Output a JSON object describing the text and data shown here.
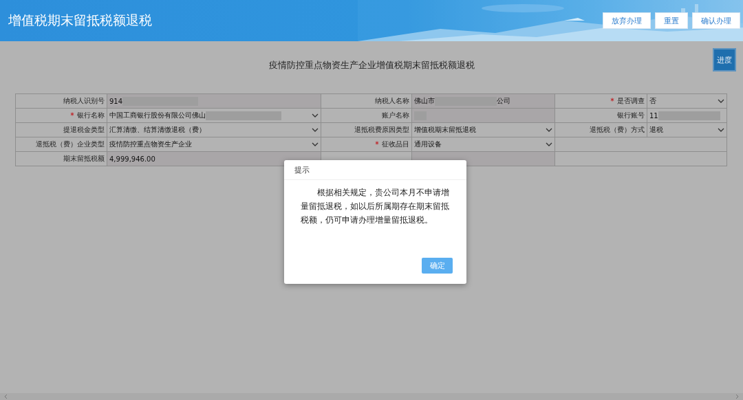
{
  "header": {
    "title": "增值税期末留抵税额退税",
    "buttons": [
      "放弃办理",
      "重置",
      "确认办理"
    ]
  },
  "page": {
    "title": "疫情防控重点物资生产企业增值税期末留抵税额退税",
    "progress_button": "进度"
  },
  "form": {
    "rows": [
      [
        {
          "label": "纳税人识别号",
          "required": false,
          "kind": "readonly",
          "segments": [
            {
              "kind": "text",
              "text": "914"
            },
            {
              "kind": "redacted"
            }
          ]
        },
        {
          "label": "纳税人名称",
          "required": false,
          "kind": "readonly",
          "segments": [
            {
              "kind": "text",
              "text": "佛山市"
            },
            {
              "kind": "redacted"
            },
            {
              "kind": "text",
              "text": "公司"
            }
          ]
        },
        {
          "label": "是否调查",
          "required": true,
          "kind": "select",
          "segments": [
            {
              "kind": "text",
              "text": "否"
            }
          ]
        }
      ],
      [
        {
          "label": "银行名称",
          "required": true,
          "kind": "select",
          "segments": [
            {
              "kind": "text",
              "text": "中国工商银行股份有限公司佛山"
            },
            {
              "kind": "redacted"
            }
          ]
        },
        {
          "label": "账户名称",
          "required": false,
          "kind": "readonly",
          "segments": [
            {
              "kind": "redacted"
            }
          ]
        },
        {
          "label": "银行账号",
          "required": false,
          "kind": "input",
          "segments": [
            {
              "kind": "text",
              "text": "11"
            },
            {
              "kind": "redacted"
            }
          ]
        }
      ],
      [
        {
          "label": "提退税金类型",
          "required": false,
          "kind": "select",
          "segments": [
            {
              "kind": "text",
              "text": "汇算清缴、结算清缴退税（费）"
            }
          ]
        },
        {
          "label": "退抵税费原因类型",
          "required": false,
          "kind": "select",
          "segments": [
            {
              "kind": "text",
              "text": "增值税期末留抵退税"
            }
          ]
        },
        {
          "label": "退抵税（费）方式",
          "required": false,
          "kind": "select",
          "segments": [
            {
              "kind": "text",
              "text": "退税"
            }
          ]
        }
      ],
      [
        {
          "label": "退抵税（费）企业类型",
          "required": false,
          "kind": "select",
          "segments": [
            {
              "kind": "text",
              "text": "疫情防控重点物资生产企业"
            }
          ]
        },
        {
          "label": "征收品目",
          "required": true,
          "kind": "select",
          "segments": [
            {
              "kind": "text",
              "text": "通用设备"
            }
          ]
        },
        {
          "kind": "empty"
        }
      ],
      [
        {
          "label": "期末留抵税额",
          "required": false,
          "kind": "readonly",
          "segments": [
            {
              "kind": "text",
              "text": "4,999,946.00"
            }
          ]
        },
        {
          "kind": "covered"
        },
        {
          "kind": "empty"
        }
      ]
    ]
  },
  "dialog": {
    "title": "提示",
    "message": "根据相关规定，贵公司本月不申请增量留抵退税，如以后所属期存在期末留抵税额，仍可申请办理增量留抵退税。",
    "button": "确定"
  }
}
